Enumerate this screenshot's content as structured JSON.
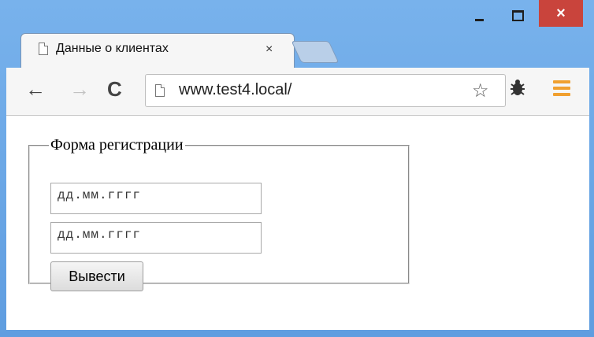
{
  "window": {
    "minimize_icon": "minimize-icon",
    "maximize_icon": "maximize-icon",
    "close_glyph": "×"
  },
  "tabs": [
    {
      "title": "Данные о клиентах",
      "close_glyph": "×",
      "active": true
    }
  ],
  "toolbar": {
    "back_glyph": "←",
    "forward_glyph": "→",
    "reload_glyph": "C",
    "url": "www.test4.local/",
    "star_glyph": "☆",
    "extension_icon": "bug-icon",
    "menu_icon": "menu-icon"
  },
  "form": {
    "legend": "Форма регистрации",
    "date1_placeholder": "дд.мм.гггг",
    "date2_placeholder": "дд.мм.гггг",
    "submit_label": "Вывести"
  },
  "colors": {
    "window_frame": "#6fa8e6",
    "close_button": "#c9443c",
    "menu_accent": "#f0a030"
  }
}
